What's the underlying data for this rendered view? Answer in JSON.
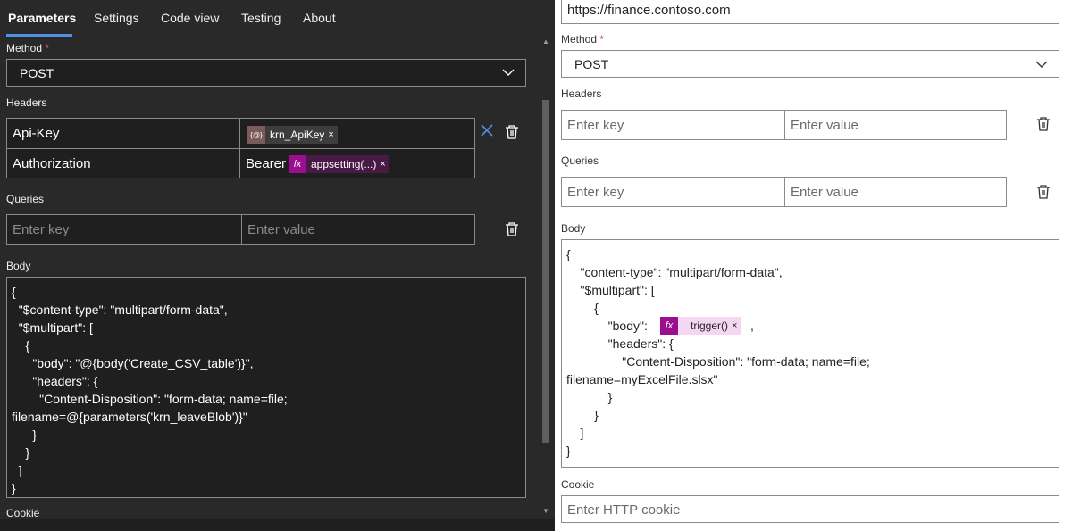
{
  "tabs": [
    "Parameters",
    "Settings",
    "Code view",
    "Testing",
    "About"
  ],
  "left": {
    "method_label": "Method",
    "required_mark": "*",
    "method_value": "POST",
    "headers_label": "Headers",
    "headers": [
      {
        "key": "Api-Key",
        "token_text": "krn_ApiKey",
        "token_icon": "{@}",
        "token_close": "×"
      },
      {
        "key": "Authorization",
        "prefix": "Bearer",
        "token_text": "appsetting(...)",
        "token_icon": "fx",
        "token_close": "×"
      }
    ],
    "queries_label": "Queries",
    "key_placeholder": "Enter key",
    "value_placeholder": "Enter value",
    "body_label": "Body",
    "body_lines": [
      "{",
      "  \"$content-type\": \"multipart/form-data\",",
      "  \"$multipart\": [",
      "    {",
      "      \"body\": \"@{body('Create_CSV_table')}\",",
      "      \"headers\": {",
      "        \"Content-Disposition\": \"form-data; name=file;",
      "filename=@{parameters('krn_leaveBlob')}\"",
      "      }",
      "    }",
      "  ]",
      "}"
    ],
    "cookie_label": "Cookie"
  },
  "right": {
    "uri_value": "https://finance.contoso.com",
    "method_label": "Method",
    "required_mark": "*",
    "method_value": "POST",
    "headers_label": "Headers",
    "key_placeholder": "Enter key",
    "value_placeholder": "Enter value",
    "queries_label": "Queries",
    "body_label": "Body",
    "body_lines": [
      "{",
      "    \"content-type\": \"multipart/form-data\",",
      "    \"$multipart\": [",
      "        {",
      "            \"body\":",
      "            \"headers\": {",
      "                \"Content-Disposition\": \"form-data; name=file;",
      "filename=myExcelFile.slsx\"",
      "            }",
      "        }",
      "    ]",
      "}"
    ],
    "body_token": {
      "icon": "fx",
      "text": "trigger()",
      "close": "×",
      "suffix": ","
    },
    "cookie_label": "Cookie",
    "cookie_placeholder": "Enter HTTP cookie"
  },
  "colors": {
    "accent": "#4f8fe6",
    "param_token": "#7a5a5a",
    "fx_token": "#9b0e8f",
    "fx_token_light": "#f5d7f2"
  }
}
